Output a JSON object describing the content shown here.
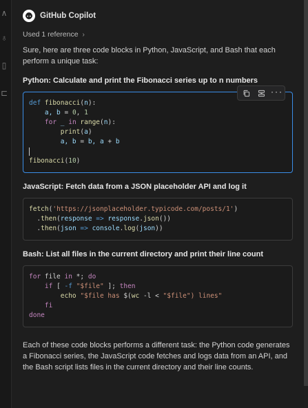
{
  "assistant": {
    "name": "GitHub Copilot",
    "references_label": "Used 1 reference"
  },
  "message": {
    "intro": "Sure, here are three code blocks in Python, JavaScript, and Bash that each perform a unique task:",
    "sections": [
      {
        "title": "Python: Calculate and print the Fibonacci series up to n numbers",
        "language": "python",
        "lines": [
          [
            {
              "t": "def ",
              "c": "k"
            },
            {
              "t": "fibonacci",
              "c": "f"
            },
            {
              "t": "(",
              "c": "dim"
            },
            {
              "t": "n",
              "c": "p"
            },
            {
              "t": "):",
              "c": "dim"
            }
          ],
          [
            {
              "t": "    a, b ",
              "c": "p"
            },
            {
              "t": "= ",
              "c": "dim"
            },
            {
              "t": "0",
              "c": "n"
            },
            {
              "t": ", ",
              "c": "dim"
            },
            {
              "t": "1",
              "c": "n"
            }
          ],
          [
            {
              "t": "    ",
              "c": "dim"
            },
            {
              "t": "for",
              "c": "ctl"
            },
            {
              "t": " _ ",
              "c": "p"
            },
            {
              "t": "in ",
              "c": "ctl"
            },
            {
              "t": "range",
              "c": "f"
            },
            {
              "t": "(",
              "c": "dim"
            },
            {
              "t": "n",
              "c": "p"
            },
            {
              "t": "):",
              "c": "dim"
            }
          ],
          [
            {
              "t": "        ",
              "c": "dim"
            },
            {
              "t": "print",
              "c": "f"
            },
            {
              "t": "(",
              "c": "dim"
            },
            {
              "t": "a",
              "c": "p"
            },
            {
              "t": ")",
              "c": "dim"
            }
          ],
          [
            {
              "t": "        a, b ",
              "c": "p"
            },
            {
              "t": "= ",
              "c": "dim"
            },
            {
              "t": "b, a ",
              "c": "p"
            },
            {
              "t": "+ ",
              "c": "dim"
            },
            {
              "t": "b",
              "c": "p"
            }
          ],
          [
            {
              "t": "",
              "c": "cursor"
            }
          ],
          [
            {
              "t": "fibonacci",
              "c": "f"
            },
            {
              "t": "(",
              "c": "dim"
            },
            {
              "t": "10",
              "c": "n"
            },
            {
              "t": ")",
              "c": "dim"
            }
          ]
        ],
        "focused": true
      },
      {
        "title": "JavaScript: Fetch data from a JSON placeholder API and log it",
        "language": "javascript",
        "lines": [
          [
            {
              "t": "fetch",
              "c": "f"
            },
            {
              "t": "(",
              "c": "dim"
            },
            {
              "t": "'https://jsonplaceholder.typicode.com/posts/1'",
              "c": "s"
            },
            {
              "t": ")",
              "c": "dim"
            }
          ],
          [
            {
              "t": "  .",
              "c": "dim"
            },
            {
              "t": "then",
              "c": "f"
            },
            {
              "t": "(",
              "c": "dim"
            },
            {
              "t": "response",
              "c": "p"
            },
            {
              "t": " => ",
              "c": "k"
            },
            {
              "t": "response",
              "c": "p"
            },
            {
              "t": ".",
              "c": "dim"
            },
            {
              "t": "json",
              "c": "f"
            },
            {
              "t": "())",
              "c": "dim"
            }
          ],
          [
            {
              "t": "  .",
              "c": "dim"
            },
            {
              "t": "then",
              "c": "f"
            },
            {
              "t": "(",
              "c": "dim"
            },
            {
              "t": "json",
              "c": "p"
            },
            {
              "t": " => ",
              "c": "k"
            },
            {
              "t": "console",
              "c": "p"
            },
            {
              "t": ".",
              "c": "dim"
            },
            {
              "t": "log",
              "c": "f"
            },
            {
              "t": "(",
              "c": "dim"
            },
            {
              "t": "json",
              "c": "p"
            },
            {
              "t": "))",
              "c": "dim"
            }
          ]
        ],
        "focused": false
      },
      {
        "title": "Bash: List all files in the current directory and print their line count",
        "language": "bash",
        "lines": [
          [
            {
              "t": "for",
              "c": "ctl"
            },
            {
              "t": " file ",
              "c": "dim"
            },
            {
              "t": "in",
              "c": "ctl"
            },
            {
              "t": " *; ",
              "c": "dim"
            },
            {
              "t": "do",
              "c": "ctl"
            }
          ],
          [
            {
              "t": "    ",
              "c": "dim"
            },
            {
              "t": "if",
              "c": "ctl"
            },
            {
              "t": " [ ",
              "c": "dim"
            },
            {
              "t": "-f ",
              "c": "k"
            },
            {
              "t": "\"$file\"",
              "c": "s"
            },
            {
              "t": " ]; ",
              "c": "dim"
            },
            {
              "t": "then",
              "c": "ctl"
            }
          ],
          [
            {
              "t": "        ",
              "c": "dim"
            },
            {
              "t": "echo",
              "c": "f"
            },
            {
              "t": " ",
              "c": "dim"
            },
            {
              "t": "\"$file has ",
              "c": "s"
            },
            {
              "t": "$(",
              "c": "dim"
            },
            {
              "t": "wc",
              "c": "f"
            },
            {
              "t": " -l < ",
              "c": "dim"
            },
            {
              "t": "\"$file\"",
              "c": "s"
            },
            {
              "t": ") lines\"",
              "c": "s"
            }
          ],
          [
            {
              "t": "    ",
              "c": "dim"
            },
            {
              "t": "fi",
              "c": "ctl"
            }
          ],
          [
            {
              "t": "done",
              "c": "ctl"
            }
          ]
        ],
        "focused": false
      }
    ],
    "outro": "Each of these code blocks performs a different task: the Python code generates a Fibonacci series, the JavaScript code fetches and logs data from an API, and the Bash script lists files in the current directory and their line counts."
  },
  "code_toolbar": {
    "copy_icon": "copy-icon",
    "insert_icon": "insert-at-cursor-icon",
    "more_label": "···"
  },
  "colors": {
    "panel_bg": "#1e1e1e",
    "focus_border": "#3b8ee9",
    "keyword": "#569cd6",
    "function": "#dcdcaa",
    "string": "#ce9178",
    "number": "#b5cea8"
  }
}
